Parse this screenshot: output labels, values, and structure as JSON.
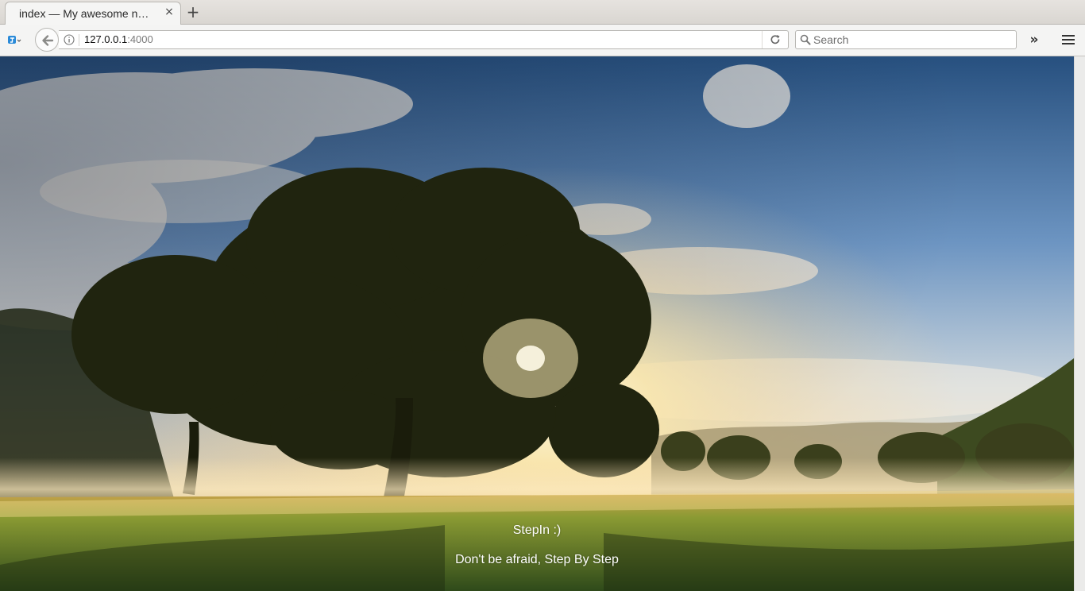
{
  "browser": {
    "tab": {
      "title": "index — My awesome n…",
      "close_symbol": "×"
    },
    "newtab_symbol": "+",
    "url": {
      "host": "127.0.0.1",
      "port": ":4000"
    },
    "search": {
      "placeholder": "Search"
    },
    "overflow_symbol": "»"
  },
  "page": {
    "heading": "StepIn :)",
    "tagline": "Don't be afraid, Step By Step"
  },
  "colors": {
    "sky_top": "#2e5b8e",
    "sky_mid": "#7ea3c9",
    "sun_glow": "#fff3c4",
    "grass": "#6f8a2c",
    "tree": "#1f2411"
  }
}
